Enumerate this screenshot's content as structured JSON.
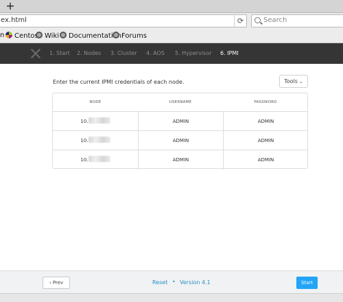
{
  "browser": {
    "newtab_label": "+",
    "url": "ex.html",
    "reload_glyph": "⟳",
    "search_placeholder": "Search",
    "bookmarks": [
      {
        "label": "n",
        "icon": "none"
      },
      {
        "label": "Centos",
        "icon": "centos-icon"
      },
      {
        "label": "Wiki",
        "icon": "globe-icon"
      },
      {
        "label": "Documentation",
        "icon": "globe-icon"
      },
      {
        "label": "Forums",
        "icon": "globe-icon"
      }
    ]
  },
  "header": {
    "logo_icon": "x-logo-icon",
    "steps": [
      {
        "label": "1. Start"
      },
      {
        "label": "2. Nodes"
      },
      {
        "label": "3. Cluster"
      },
      {
        "label": "4. AOS"
      },
      {
        "label": "5. Hypervisor"
      },
      {
        "label": "6. IPMI",
        "active": true
      }
    ]
  },
  "main": {
    "instruction": "Enter the current IPMI credentials of each node.",
    "tools_label": "Tools",
    "tools_chevron": "⌄",
    "table": {
      "headers": [
        "NODE",
        "USERNAME",
        "PASSWORD"
      ],
      "rows": [
        {
          "node": "10.",
          "username": "ADMIN",
          "password": "ADMIN"
        },
        {
          "node": "10.",
          "username": "ADMIN",
          "password": "ADMIN"
        },
        {
          "node": "10.",
          "username": "ADMIN",
          "password": "ADMIN"
        }
      ]
    }
  },
  "footer": {
    "prev_label": "‹ Prev",
    "reset_label": "Reset",
    "separator": "•",
    "version_label": "Version 4.1",
    "start_label": "Start"
  },
  "colors": {
    "header_bg": "#353535",
    "link": "#2a8fc6",
    "primary": "#22a5f7"
  }
}
